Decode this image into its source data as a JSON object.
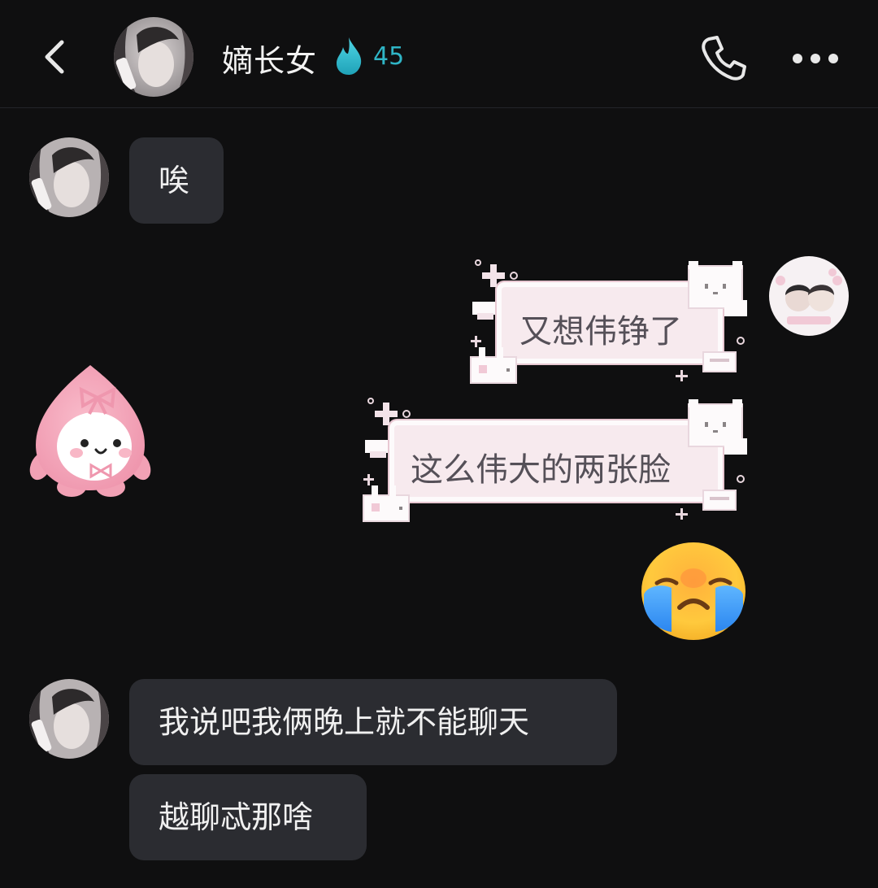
{
  "header": {
    "title": "嫡长女",
    "spark_count": "45",
    "back_icon": "chevron-left-icon",
    "call_icon": "phone-icon",
    "more_icon": "more-dots-icon",
    "spark_icon": "droplet-flame-icon",
    "spark_color": "#2fb5c6"
  },
  "messages": [
    {
      "id": "m1",
      "side": "incoming",
      "text": "唉"
    },
    {
      "id": "m2",
      "side": "outgoing",
      "text": "又想伟铮了",
      "style": "pink-pixel-bubble"
    },
    {
      "id": "m3",
      "side": "incoming",
      "type": "sticker",
      "sticker": "pink-peach-mascot"
    },
    {
      "id": "m4",
      "side": "outgoing",
      "text": "这么伟大的两张脸",
      "style": "pink-pixel-bubble"
    },
    {
      "id": "m5",
      "side": "outgoing",
      "type": "emoji",
      "emoji": "loudly-crying-face"
    },
    {
      "id": "m6",
      "side": "incoming",
      "text": "我说吧我俩晚上就不能聊天"
    },
    {
      "id": "m7",
      "side": "incoming",
      "text": "越聊忒那啥"
    }
  ],
  "colors": {
    "background": "#0f0f10",
    "incoming_bubble": "#2b2c31",
    "outgoing_bubble": "#f7eaee"
  }
}
